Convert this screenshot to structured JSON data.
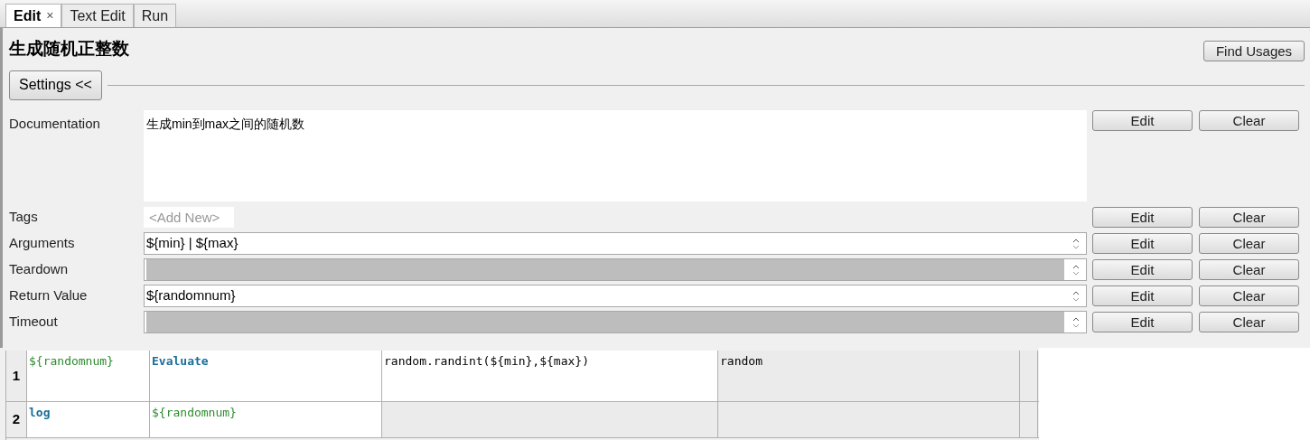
{
  "tabs": [
    {
      "label": "Edit",
      "selected": true,
      "close": "×"
    },
    {
      "label": "Text Edit",
      "selected": false
    },
    {
      "label": "Run",
      "selected": false
    }
  ],
  "title": "生成随机正整数",
  "find_usages": "Find Usages",
  "settings_button": "Settings <<",
  "documentation": {
    "label": "Documentation",
    "value": "生成min到max之间的随机数",
    "buttons": [
      "Edit",
      "Clear"
    ]
  },
  "tags": {
    "label": "Tags",
    "placeholder": "<Add New>",
    "buttons": [
      "Edit",
      "Clear"
    ]
  },
  "fields": [
    {
      "label": "Arguments",
      "value": "${min} | ${max}",
      "disabled": false,
      "buttons": [
        "Edit",
        "Clear"
      ]
    },
    {
      "label": "Teardown",
      "disabled": true,
      "buttons": [
        "Edit",
        "Clear"
      ]
    },
    {
      "label": "Return Value",
      "value": "${randomnum}",
      "disabled": false,
      "buttons": [
        "Edit",
        "Clear"
      ]
    },
    {
      "label": "Timeout",
      "disabled": true,
      "buttons": [
        "Edit",
        "Clear"
      ]
    }
  ],
  "grid": {
    "rows": [
      {
        "number": "1",
        "cells": [
          {
            "kind": "variable",
            "text": "${randomnum}",
            "shaded": false
          },
          {
            "kind": "keyword",
            "text": "Evaluate",
            "shaded": false
          },
          {
            "kind": "plain",
            "text": "random.randint(${min},${max})",
            "shaded": false
          },
          {
            "kind": "plain",
            "text": "random",
            "shaded": true
          },
          {
            "kind": "empty",
            "shaded": true
          }
        ]
      },
      {
        "number": "2",
        "cells": [
          {
            "kind": "keyword",
            "text": "log",
            "shaded": false
          },
          {
            "kind": "variable",
            "text": "${randomnum}",
            "shaded": false
          },
          {
            "kind": "empty",
            "shaded": true
          },
          {
            "kind": "empty",
            "shaded": true
          },
          {
            "kind": "empty",
            "shaded": true
          }
        ]
      }
    ]
  }
}
